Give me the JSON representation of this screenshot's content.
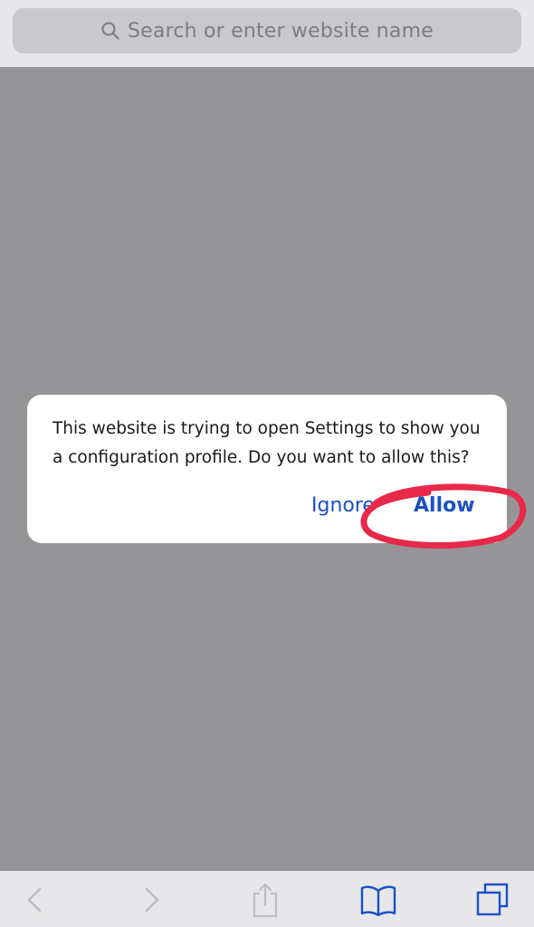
{
  "search": {
    "placeholder": "Search or enter website name"
  },
  "alert": {
    "message": "This website is trying to open Settings to show you a configuration profile. Do you want to allow this?",
    "ignore_label": "Ignore",
    "allow_label": "Allow"
  },
  "toolbar": {
    "icons": [
      "back-icon",
      "forward-icon",
      "share-icon",
      "bookmarks-icon",
      "tabs-icon"
    ]
  },
  "colors": {
    "accent": "#1b50c7",
    "highlight": "#e8294a",
    "dimmed_background": "#959597",
    "bar_background": "#e7e7e9"
  }
}
